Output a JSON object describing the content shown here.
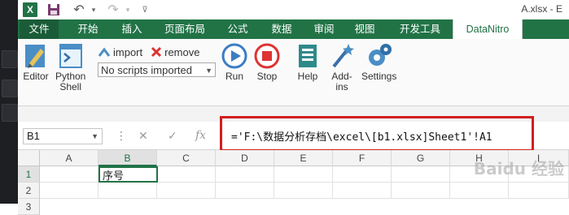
{
  "window": {
    "title": "A.xlsx - E"
  },
  "quick_access": {
    "excel_logo": "X"
  },
  "tabs": [
    {
      "label": "文件"
    },
    {
      "label": "开始"
    },
    {
      "label": "插入"
    },
    {
      "label": "页面布局"
    },
    {
      "label": "公式"
    },
    {
      "label": "数据"
    },
    {
      "label": "审阅"
    },
    {
      "label": "视图"
    },
    {
      "label": "开发工具"
    },
    {
      "label": "DataNitro"
    }
  ],
  "ribbon": {
    "editor": "Editor",
    "python_shell_line1": "Python",
    "python_shell_line2": "Shell",
    "import": "import",
    "remove": "remove",
    "scripts_select": "No scripts imported",
    "run": "Run",
    "stop": "Stop",
    "help": "Help",
    "addins_line1": "Add-",
    "addins_line2": "ins",
    "settings": "Settings"
  },
  "formula_bar": {
    "name_box": "B1",
    "formula": "='F:\\数据分析存档\\excel\\[b1.xlsx]Sheet1'!A1"
  },
  "grid": {
    "columns": [
      "A",
      "B",
      "C",
      "D",
      "E",
      "F",
      "G",
      "H",
      "I"
    ],
    "rows": [
      "1",
      "2",
      "3"
    ],
    "cells": {
      "B1": "序号"
    }
  },
  "watermark": "Baidu 经验",
  "colors": {
    "accent": "#217346",
    "highlight": "#d11f1f"
  }
}
